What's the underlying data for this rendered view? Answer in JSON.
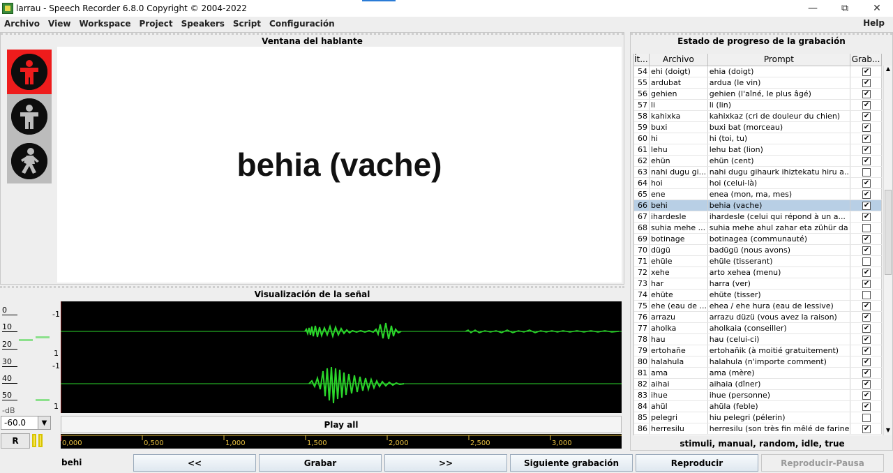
{
  "window": {
    "title": "larrau - Speech Recorder 6.8.0 Copyright © 2004-2022",
    "minimize": "—",
    "maximize": "⧉",
    "close": "✕"
  },
  "menu": {
    "items": [
      "Archivo",
      "View",
      "Workspace",
      "Project",
      "Speakers",
      "Script",
      "Configuración"
    ],
    "help": "Help"
  },
  "speaker_window": {
    "title": "Ventana del hablante",
    "prompt": "behia (vache)",
    "lights": [
      "red-stop",
      "gray-ready",
      "gray-go"
    ]
  },
  "signal": {
    "title": "Visualización de la señal",
    "vu_ticks": [
      "0",
      "10",
      "20",
      "30",
      "40",
      "50"
    ],
    "db_label": "-dB",
    "db_value": "-60.0",
    "r_button": "R",
    "axis_labels": [
      "-1",
      "1",
      "-1",
      "1"
    ],
    "play_all": "Play all",
    "timeline": [
      "0,000",
      "0,500",
      "1,000",
      "1,500",
      "2,000",
      "2,500",
      "3,000"
    ]
  },
  "progress": {
    "title": "Estado de progreso de la grabación",
    "columns": [
      "Ít...",
      "Archivo",
      "Prompt",
      "Grab..."
    ],
    "mode": "stimuli, manual, random, idle, true",
    "selected_index": 12,
    "rows": [
      {
        "n": "54",
        "file": "ehi (doigt)",
        "prompt": "ehia (doigt)",
        "rec": true
      },
      {
        "n": "55",
        "file": "ardubat",
        "prompt": "ardua (le vin)",
        "rec": true
      },
      {
        "n": "56",
        "file": "gehien",
        "prompt": "gehien (l'aîné, le plus âgé)",
        "rec": true
      },
      {
        "n": "57",
        "file": "li",
        "prompt": "li (lin)",
        "rec": true
      },
      {
        "n": "58",
        "file": "kahixka",
        "prompt": "kahixkaz (cri de douleur du chien)",
        "rec": true
      },
      {
        "n": "59",
        "file": "buxi",
        "prompt": "buxi bat (morceau)",
        "rec": true
      },
      {
        "n": "60",
        "file": "hi",
        "prompt": "hi (toi, tu)",
        "rec": true
      },
      {
        "n": "61",
        "file": "lehu",
        "prompt": "lehu bat (lion)",
        "rec": true
      },
      {
        "n": "62",
        "file": "ehün",
        "prompt": "ehün (cent)",
        "rec": true
      },
      {
        "n": "63",
        "file": "nahi dugu gi...",
        "prompt": "nahi dugu gihaurk ihiztekatu hiru a...",
        "rec": false
      },
      {
        "n": "64",
        "file": "hoi",
        "prompt": "hoi (celui-là)",
        "rec": true
      },
      {
        "n": "65",
        "file": "ene",
        "prompt": "enea (mon, ma, mes)",
        "rec": true
      },
      {
        "n": "66",
        "file": "behi",
        "prompt": "behia (vache)",
        "rec": true
      },
      {
        "n": "67",
        "file": "ihardesle",
        "prompt": "ihardesle (celui qui répond à un a...",
        "rec": true
      },
      {
        "n": "68",
        "file": "suhia mehe ...",
        "prompt": "suhia mehe ahul zahar eta zühür da",
        "rec": false
      },
      {
        "n": "69",
        "file": "botinage",
        "prompt": "botinagea (communauté)",
        "rec": true
      },
      {
        "n": "70",
        "file": "dügü",
        "prompt": "badügü (nous avons)",
        "rec": true
      },
      {
        "n": "71",
        "file": "ehüle",
        "prompt": "ehüle (tisserant)",
        "rec": false
      },
      {
        "n": "72",
        "file": "xehe",
        "prompt": "arto xehea (menu)",
        "rec": true
      },
      {
        "n": "73",
        "file": "har",
        "prompt": "harra (ver)",
        "rec": true
      },
      {
        "n": "74",
        "file": "ehüte",
        "prompt": "ehüte (tisser)",
        "rec": false
      },
      {
        "n": "75",
        "file": "ehe (eau de ...",
        "prompt": "ehea / ehe hura (eau de lessive)",
        "rec": true
      },
      {
        "n": "76",
        "file": "arrazu",
        "prompt": "arrazu düzü (vous avez la raison)",
        "rec": true
      },
      {
        "n": "77",
        "file": "aholka",
        "prompt": "aholkaia (conseiller)",
        "rec": true
      },
      {
        "n": "78",
        "file": "hau",
        "prompt": "hau (celui-ci)",
        "rec": true
      },
      {
        "n": "79",
        "file": "ertohañe",
        "prompt": "ertohañik (à moitié gratuitement)",
        "rec": true
      },
      {
        "n": "80",
        "file": "halahula",
        "prompt": "halahula (n'importe comment)",
        "rec": true
      },
      {
        "n": "81",
        "file": "ama",
        "prompt": "ama (mère)",
        "rec": true
      },
      {
        "n": "82",
        "file": "aihai",
        "prompt": "aihaia (dîner)",
        "rec": true
      },
      {
        "n": "83",
        "file": "ihue",
        "prompt": "ihue (personne)",
        "rec": true
      },
      {
        "n": "84",
        "file": "ahül",
        "prompt": "ahüla (feble)",
        "rec": true
      },
      {
        "n": "85",
        "file": "pelegri",
        "prompt": "hiu pelegri (pélerin)",
        "rec": false
      },
      {
        "n": "86",
        "file": "herresilu",
        "prompt": "herresilu (son très fin mêlé de farine)",
        "rec": true
      }
    ]
  },
  "bottom": {
    "current_file": "behi",
    "buttons": [
      "<<",
      "Grabar",
      ">>",
      "Siguiente grabación",
      "Reproducir",
      "Reproducir-Pausa"
    ]
  },
  "colors": {
    "waveform": "#2bd62b",
    "light_red": "#ee1c1c",
    "selected_row": "#b8cfe5",
    "timeline_text": "#e8c040"
  }
}
